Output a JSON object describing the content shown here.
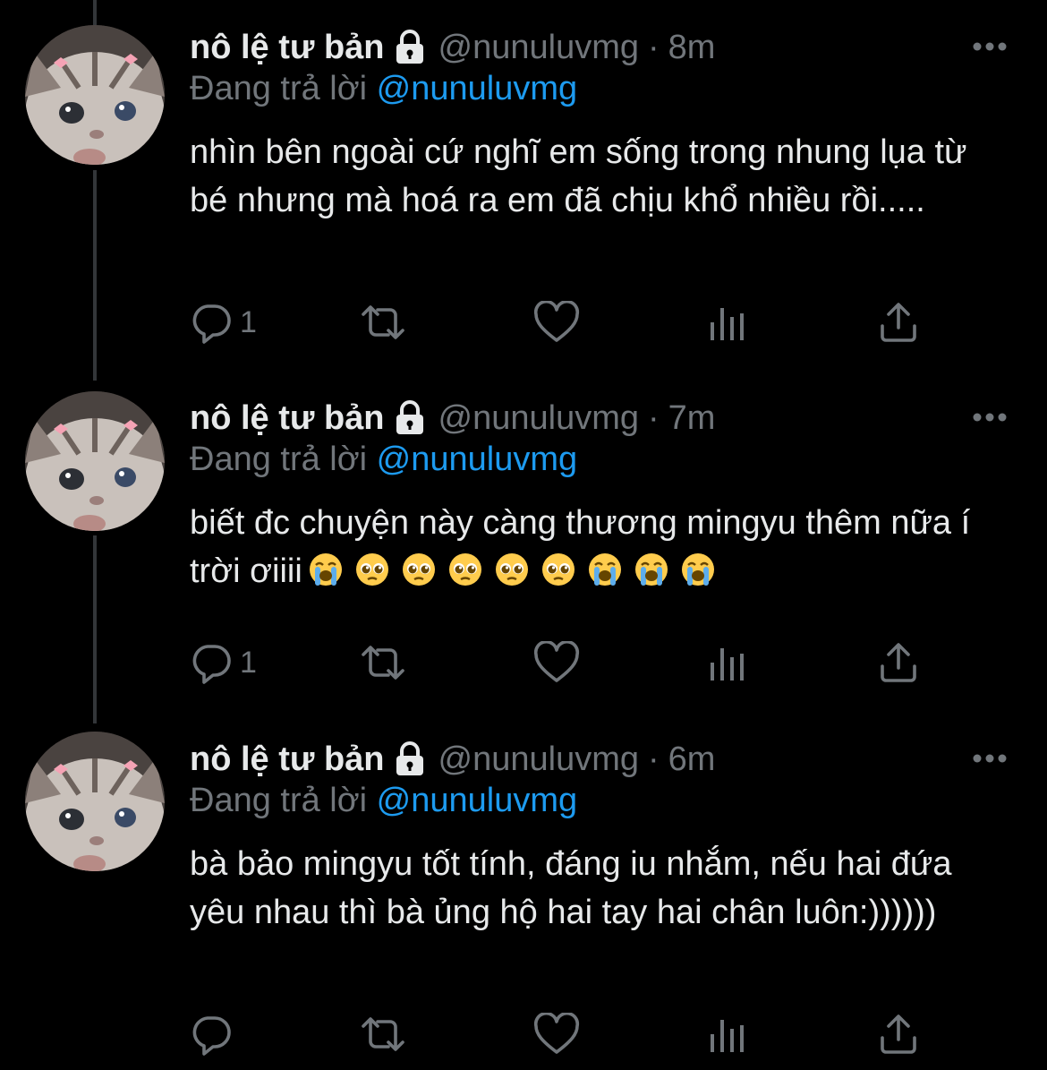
{
  "colors": {
    "background": "#000000",
    "text": "#e7e9ea",
    "muted": "#71767b",
    "accent": "#1d9bf0",
    "thread_line": "#333639"
  },
  "tweets": [
    {
      "display_name": "nô lệ tư bản",
      "handle": "@nunuluvmg",
      "separator": "·",
      "time": "8m",
      "replying_prefix": "Đang trả lời",
      "replying_to": "@nunuluvmg",
      "text": "nhìn bên ngoài cứ nghĩ em sống trong nhung lụa từ bé nhưng mà hoá ra em đã chịu khổ nhiều rồi.....",
      "emojis": [],
      "reply_count": "1",
      "icons": [
        "lock-icon",
        "more-icon",
        "reply-icon",
        "retweet-icon",
        "like-icon",
        "analytics-icon",
        "share-icon"
      ]
    },
    {
      "display_name": "nô lệ tư bản",
      "handle": "@nunuluvmg",
      "separator": "·",
      "time": "7m",
      "replying_prefix": "Đang trả lời",
      "replying_to": "@nunuluvmg",
      "text": "biết đc chuyện này càng thương mingyu thêm nữa í trời ơiiii",
      "emojis": [
        "loudly-crying-face",
        "pleading-face",
        "pleading-face",
        "pleading-face",
        "pleading-face",
        "pleading-face",
        "loudly-crying-face",
        "loudly-crying-face",
        "loudly-crying-face"
      ],
      "reply_count": "1",
      "icons": [
        "lock-icon",
        "more-icon",
        "reply-icon",
        "retweet-icon",
        "like-icon",
        "analytics-icon",
        "share-icon"
      ]
    },
    {
      "display_name": "nô lệ tư bản",
      "handle": "@nunuluvmg",
      "separator": "·",
      "time": "6m",
      "replying_prefix": "Đang trả lời",
      "replying_to": "@nunuluvmg",
      "text": "bà bảo mingyu tốt tính, đáng iu nhắm, nếu hai đứa yêu nhau thì bà ủng hộ hai tay hai chân luôn:))))))",
      "emojis": [],
      "reply_count": "",
      "icons": [
        "lock-icon",
        "more-icon",
        "reply-icon",
        "retweet-icon",
        "like-icon",
        "analytics-icon",
        "share-icon"
      ]
    }
  ]
}
